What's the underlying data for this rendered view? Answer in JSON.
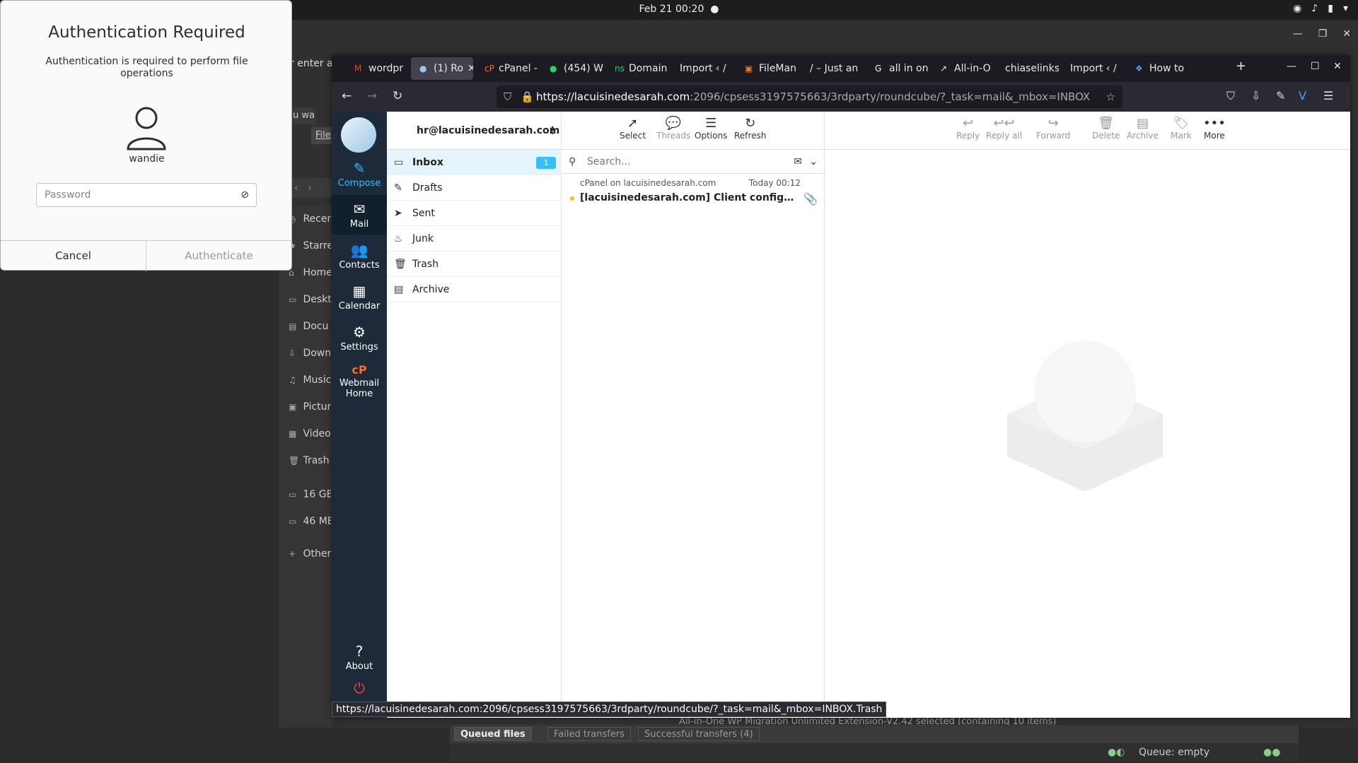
{
  "topbar": {
    "clock": "Feb 21  00:20",
    "dot": "●"
  },
  "auth_dialog": {
    "title": "Authentication Required",
    "message": "Authentication is required to perform file operations",
    "username": "wandie",
    "password_placeholder": "Password",
    "cancel_label": "Cancel",
    "authenticate_label": "Authenticate"
  },
  "file_manager": {
    "partial_text": "r enter a",
    "sidebar": [
      {
        "label": "Recen",
        "icon": "clock-icon"
      },
      {
        "label": "Starre",
        "icon": "star-icon"
      },
      {
        "label": "Home",
        "icon": "home-icon"
      },
      {
        "label": "Deskt",
        "icon": "desktop-icon"
      },
      {
        "label": "Docu",
        "icon": "document-icon"
      },
      {
        "label": "Down",
        "icon": "download-icon"
      },
      {
        "label": "Music",
        "icon": "music-icon"
      },
      {
        "label": "Pictur",
        "icon": "picture-icon"
      },
      {
        "label": "Video",
        "icon": "video-icon"
      },
      {
        "label": "Trash",
        "icon": "trash-icon"
      },
      {
        "label": "16 GB",
        "icon": "drive-icon"
      },
      {
        "label": "46 MB",
        "icon": "drive-icon"
      },
      {
        "label": "Other",
        "icon": "plus-icon"
      }
    ],
    "snippets": [
      "u wa",
      "File"
    ]
  },
  "ftp": {
    "status": "All-in-One WP Migration Unlimited Extension-V2.42  selected  (containing 10 items)",
    "tabs": [
      "Queued files",
      "Failed transfers",
      "Successful transfers (4)"
    ],
    "queue": "Queue: empty"
  },
  "browser": {
    "tabs": [
      {
        "label": "wordpr",
        "icon": "gmail-icon",
        "active": false
      },
      {
        "label": "(1) Ro",
        "icon": "roundcube-icon",
        "active": true
      },
      {
        "label": "cPanel -",
        "icon": "cpanel-icon",
        "active": false
      },
      {
        "label": "(454) W",
        "icon": "whatsapp-icon",
        "active": false
      },
      {
        "label": "Domain",
        "icon": "ns-icon",
        "active": false
      },
      {
        "label": "Import ‹ /",
        "icon": "",
        "active": false
      },
      {
        "label": "FileMan",
        "icon": "filemanager-icon",
        "active": false
      },
      {
        "label": "/ – Just an",
        "icon": "",
        "active": false
      },
      {
        "label": "all in on",
        "icon": "google-icon",
        "active": false
      },
      {
        "label": "All-in-O",
        "icon": "external-icon",
        "active": false
      },
      {
        "label": "chiaselinks",
        "icon": "",
        "active": false
      },
      {
        "label": "Import ‹ /",
        "icon": "",
        "active": false
      },
      {
        "label": "How to",
        "icon": "link-icon",
        "active": false
      }
    ],
    "url_host": "https://lacuisinedesarah.com",
    "url_path": ":2096/cpsess3197575663/3rdparty/roundcube/?_task=mail&_mbox=INBOX",
    "status_url": "https://lacuisinedesarah.com:2096/cpsess3197575663/3rdparty/roundcube/?_task=mail&_mbox=INBOX.Trash"
  },
  "roundcube": {
    "nav": [
      {
        "label": "Compose"
      },
      {
        "label": "Mail"
      },
      {
        "label": "Contacts"
      },
      {
        "label": "Calendar"
      },
      {
        "label": "Settings"
      },
      {
        "label": "Webmail Home"
      },
      {
        "label": "About"
      }
    ],
    "account": "hr@lacuisinedesarah.com",
    "folders": [
      {
        "label": "Inbox",
        "badge": "1"
      },
      {
        "label": "Drafts"
      },
      {
        "label": "Sent"
      },
      {
        "label": "Junk"
      },
      {
        "label": "Trash"
      },
      {
        "label": "Archive"
      }
    ],
    "list_toolbar": [
      "Select",
      "Threads",
      "Options",
      "Refresh"
    ],
    "search_placeholder": "Search...",
    "message": {
      "from": "cPanel on lacuisinedesarah.com",
      "date": "Today 00:12",
      "subject": "[lacuisinedesarah.com] Client configuration set..."
    },
    "preview_toolbar": [
      "Reply",
      "Reply all",
      "Forward",
      "Delete",
      "Archive",
      "Mark",
      "More"
    ]
  },
  "colors": {
    "accent": "#37beff",
    "nav_bg": "#1c2a3a",
    "unread_dot": "#ffbf00"
  }
}
